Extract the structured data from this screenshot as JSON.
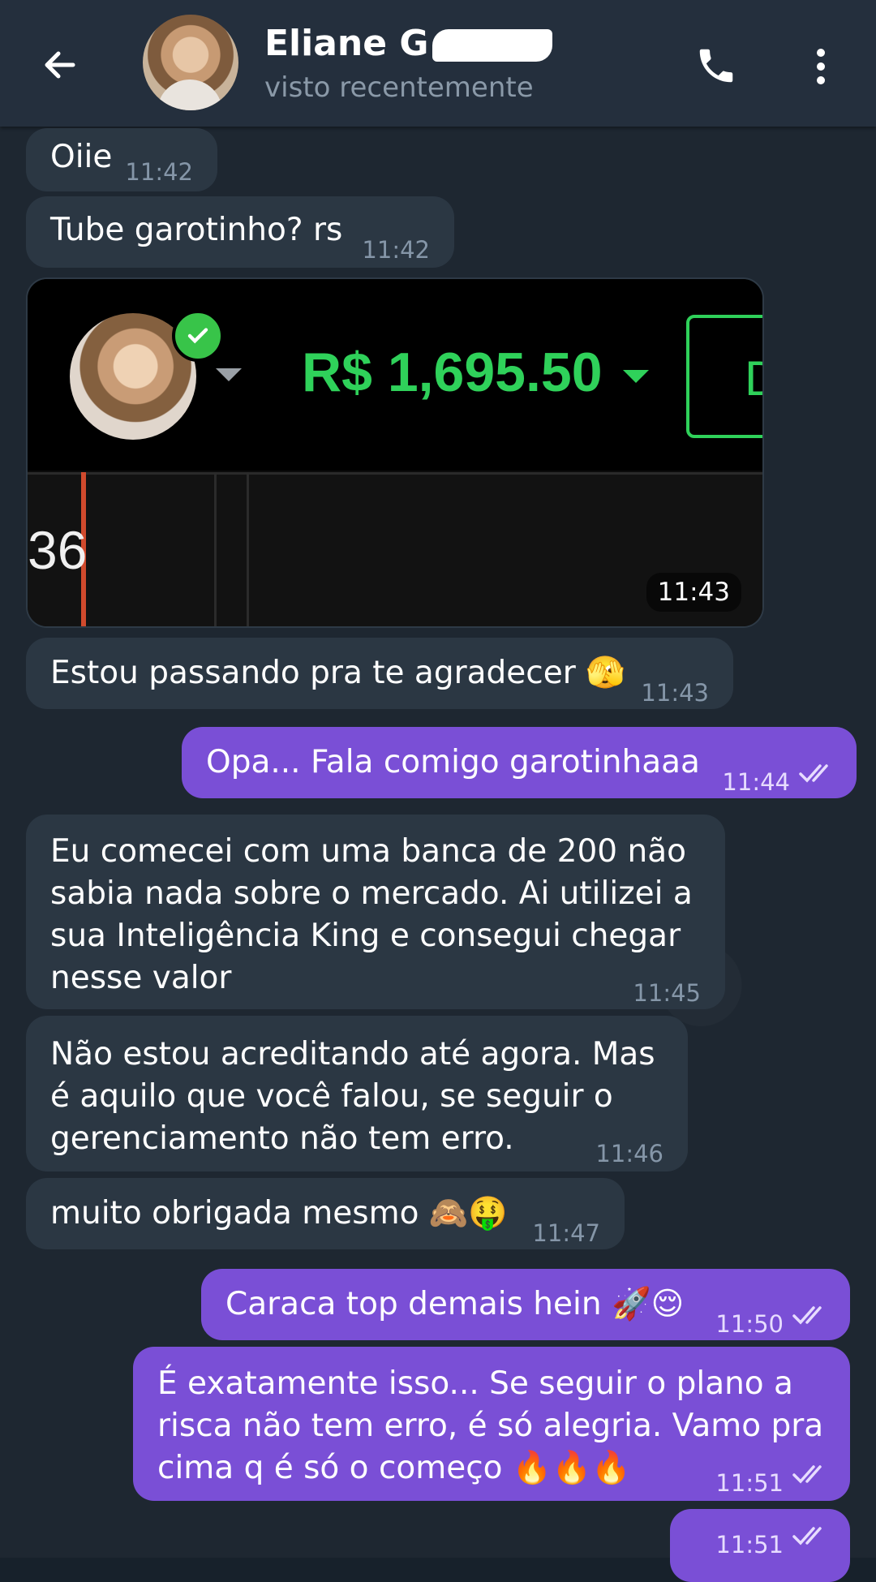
{
  "header": {
    "back_label": "back",
    "name": "Eliane G",
    "status": "visto recentemente"
  },
  "messages": [
    {
      "dir": "in",
      "text": "Oiie",
      "time": "11:42"
    },
    {
      "dir": "in",
      "text": "Tube garotinho? rs",
      "time": "11:42"
    },
    {
      "dir": "in",
      "type": "photo",
      "time": "11:43",
      "photo": {
        "balance": "R$ 1,695.50",
        "chart_value": "36",
        "box_letter": "D"
      }
    },
    {
      "dir": "in",
      "text": "Estou passando pra te agradecer 🫣",
      "time": "11:43"
    },
    {
      "dir": "out",
      "text": "Opa... Fala comigo garotinhaaa",
      "time": "11:44",
      "read": true
    },
    {
      "dir": "in",
      "text": "Eu comecei com uma banca de 200 não\nsabia nada sobre o mercado. Ai utilizei a\nsua Inteligência King e consegui chegar\nnesse valor",
      "time": "11:45"
    },
    {
      "dir": "in",
      "text": "Não estou acreditando até agora. Mas\né aquilo que você falou, se seguir o\ngerenciamento não tem erro.",
      "time": "11:46"
    },
    {
      "dir": "in",
      "text": "muito obrigada mesmo 🙈🤑",
      "time": "11:47"
    },
    {
      "dir": "out",
      "text": "Caraca top demais hein 🚀😌",
      "time": "11:50",
      "read": true
    },
    {
      "dir": "out",
      "text": "É exatamente isso... Se seguir o plano a\nrisca não tem erro, é só alegria. Vamo pra\ncima q é só o começo 🔥🔥🔥",
      "time": "11:51",
      "read": true
    },
    {
      "dir": "out",
      "text": "",
      "time": "11:51",
      "read": true
    }
  ],
  "colors": {
    "header_bg": "#242f3d",
    "chat_bg": "#1e2731",
    "incoming_bubble": "#2b3743",
    "outgoing_bubble": "#7a4fd6",
    "balance_green": "#2fd15a"
  },
  "icons": {
    "back": "arrow-left-icon",
    "call": "phone-icon",
    "menu": "more-vert-icon",
    "read": "double-check-icon",
    "verified": "check-badge-icon"
  }
}
